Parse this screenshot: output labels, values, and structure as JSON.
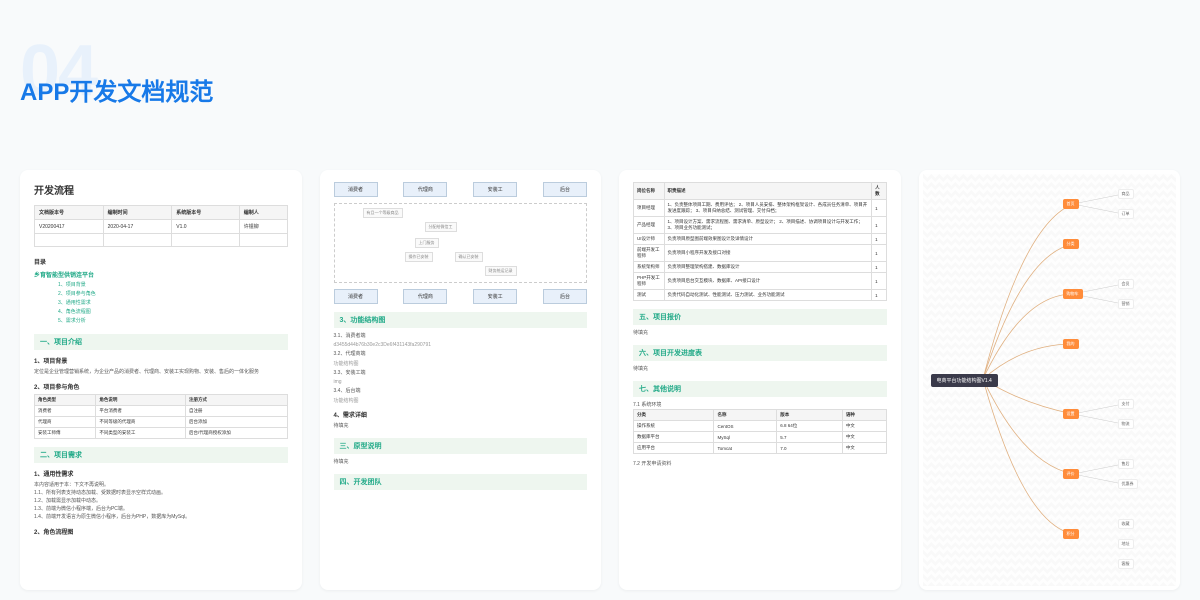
{
  "bgNumber": "04",
  "title": "APP开发文档规范",
  "card1": {
    "heading": "开发流程",
    "headers": [
      "文档版本号",
      "编制时间",
      "系统版本号",
      "编制人"
    ],
    "row": [
      "V20200417",
      "2020-04-17",
      "V1.0",
      "许锟铆"
    ],
    "tocTitle": "目录",
    "tocMain": "乡育智能型供销连平台",
    "tocItems": [
      "1、项目背景",
      "2、项目参与角色",
      "3、通用性需求",
      "4、角色流程图",
      "5、需求分析"
    ],
    "sec1": "一、项目介绍",
    "sub1": "1、项目背景",
    "bg": "定位是企业管理营销系统，为企业产品的消费者、代理商、安装工实现购物、安装、售后的一体化服务",
    "sub2": "2、项目参与角色",
    "roleHeaders": [
      "角色类型",
      "角色说明",
      "注册方式"
    ],
    "roleRows": [
      [
        "消费者",
        "平台消费者",
        "自注册"
      ],
      [
        "代理商",
        "不同等级的代理商",
        "后台添加"
      ],
      [
        "安装工师傅",
        "不同类型的安装工",
        "后台/代理商授权添加"
      ]
    ],
    "sec2": "二、项目需求",
    "sub3": "1、通用性需求",
    "req": "本内容适用于本：下文不再说明。",
    "reqItems": [
      "1.1、所有列表支持动态加载、受数据时表显示空样式动画。",
      "1.2、加载需显示加载中动态。",
      "1.3、前端为微信小程序端，后台为PC端。",
      "1.4、前端开发语言为原生微信小程序，后台为PHP，数据库为MySql。"
    ],
    "sub4": "2、角色流程图"
  },
  "card2": {
    "flowTop": [
      "消费者",
      "代理商",
      "安装工",
      "后台"
    ],
    "notes": [
      "有且一个等级商品",
      "分配给微信工",
      "上门服务",
      "操作已安装",
      "确认已安装",
      "财务统运记录"
    ],
    "flowBot": [
      "消费者",
      "代理商",
      "安装工",
      "后台"
    ],
    "sec3": "3、功能结构图",
    "s31": "3.1、消费者端",
    "img1": "d3455d44b76b30e2c3De6f431143fa290791",
    "s32": "3.2、代理商端",
    "ph1": "功能结构图",
    "s33": "3.3、安装工端",
    "ph2": "img",
    "s34": "3.4、后台端",
    "ph3": "功能结构图",
    "sec4": "4、需求详细",
    "fill1": "待填充",
    "sec5": "三、原型说明",
    "fill2": "待填充",
    "sec6": "四、开发团队"
  },
  "card3": {
    "th": [
      "岗位名称",
      "职责描述",
      "人数"
    ],
    "rows": [
      [
        "项目经理",
        "1、负责整体项目工期、费用评估；\n2、项目人员安排、整体架构框架设计、各成员任务清单、项目开发进度跟踪；\n3、项目归纳总结、测试管理、交付归档；",
        "1"
      ],
      [
        "产品经理",
        "1、项目设计方案、需求流程图、需求清单、原型设计；\n2、项目描述、协调项目设计与开发工作；\n3、项目业务功能测试；",
        "1"
      ],
      [
        "UI设计师",
        "负责项目原型图前端效果图设计及详情设计",
        "1"
      ],
      [
        "前端开发工程师",
        "负责项目小程序开发及接口对接",
        "1"
      ],
      [
        "系统架构师",
        "负责项目整理架构搭建、数据库设计",
        "1"
      ],
      [
        "PHP开发工程师",
        "负责项目后台交互模块、数据库、API接口设计",
        "1"
      ],
      [
        "测试",
        "负责代码自动化测试、性能测试、压力测试、业务功能测试",
        "1"
      ]
    ],
    "sec5": "五、项目报价",
    "fill1": "待填充",
    "sec6": "六、项目开发进度表",
    "fill2": "待填充",
    "sec7": "七、其他说明",
    "s71": "7.1 系统环境",
    "envH": [
      "分类",
      "名称",
      "版本",
      "语种"
    ],
    "envR": [
      [
        "操作系统",
        "CentOS",
        "6.8 64位",
        "中文"
      ],
      [
        "数据库平台",
        "MySql",
        "5.7",
        "中文"
      ],
      [
        "应用平台",
        "Tomcat",
        "7.0",
        "中文"
      ]
    ],
    "s72": "7.2 开发申请资料"
  },
  "card4": {
    "root": "电商平台功能结构图V1.4",
    "nodes": [
      "首页",
      "分类",
      "购物车",
      "我的",
      "商品",
      "订单",
      "会员",
      "营销",
      "设置",
      "支付",
      "物流",
      "评价",
      "售后",
      "优惠券",
      "积分",
      "收藏",
      "地址",
      "客服"
    ]
  }
}
